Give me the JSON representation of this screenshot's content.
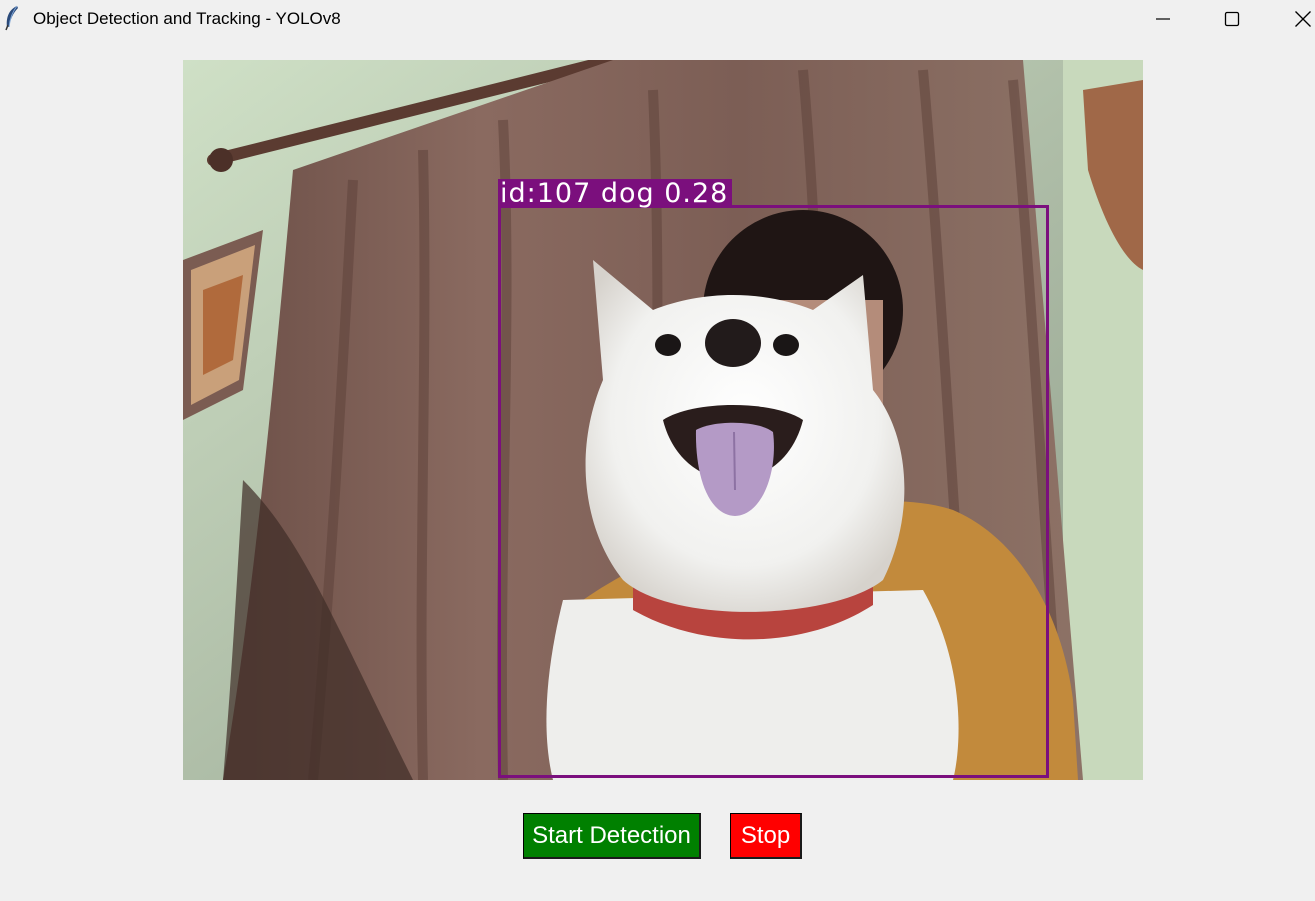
{
  "window": {
    "title": "Object Detection and Tracking - YOLOv8",
    "icon": "feather-icon"
  },
  "video": {
    "detection_label": "id:107 dog 0.28",
    "box_color": "#7b0f7d"
  },
  "controls": {
    "start_label": "Start Detection",
    "start_color": "#008000",
    "stop_label": "Stop",
    "stop_color": "#ff0000"
  }
}
